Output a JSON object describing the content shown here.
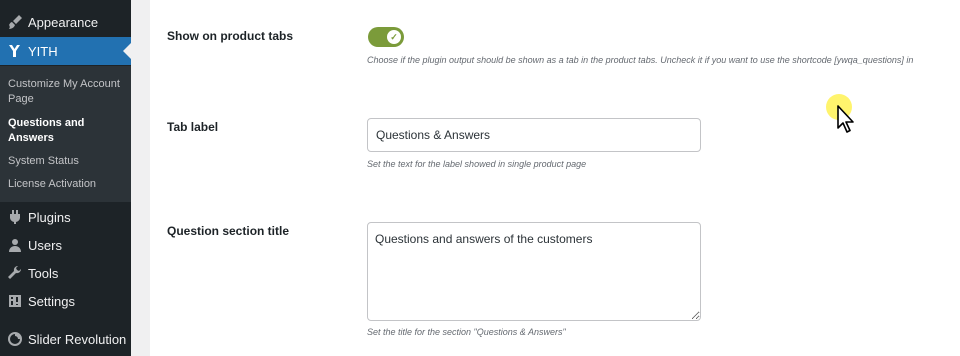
{
  "sidebar": {
    "items": [
      {
        "label": "Appearance",
        "icon": "paintbrush-icon"
      },
      {
        "label": "YITH",
        "icon": "yith-logo-icon"
      },
      {
        "label": "Plugins",
        "icon": "plugin-icon"
      },
      {
        "label": "Users",
        "icon": "user-icon"
      },
      {
        "label": "Tools",
        "icon": "wrench-icon"
      },
      {
        "label": "Settings",
        "icon": "settings-icon"
      },
      {
        "label": "Slider Revolution",
        "icon": "slider-icon"
      }
    ],
    "submenu": [
      {
        "label": "Customize My Account Page"
      },
      {
        "label": "Questions and Answers"
      },
      {
        "label": "System Status"
      },
      {
        "label": "License Activation"
      }
    ]
  },
  "settings": {
    "show_tabs": {
      "label": "Show on product tabs",
      "enabled": true,
      "description": "Choose if the plugin output should be shown as a tab in the product tabs. Uncheck it if you want to use the shortcode [ywqa_questions] in"
    },
    "tab_label": {
      "label": "Tab label",
      "value": "Questions & Answers",
      "description": "Set the text for the label showed in single product page"
    },
    "section_title": {
      "label": "Question section title",
      "value": "Questions and answers of the customers",
      "description": "Set the title for the section \"Questions & Answers\""
    }
  },
  "colors": {
    "sidebar_bg": "#1d2327",
    "submenu_bg": "#2c3338",
    "active_bg": "#2271b1",
    "toggle_on": "#7b9b3a",
    "cursor_highlight": "#fff03c"
  }
}
